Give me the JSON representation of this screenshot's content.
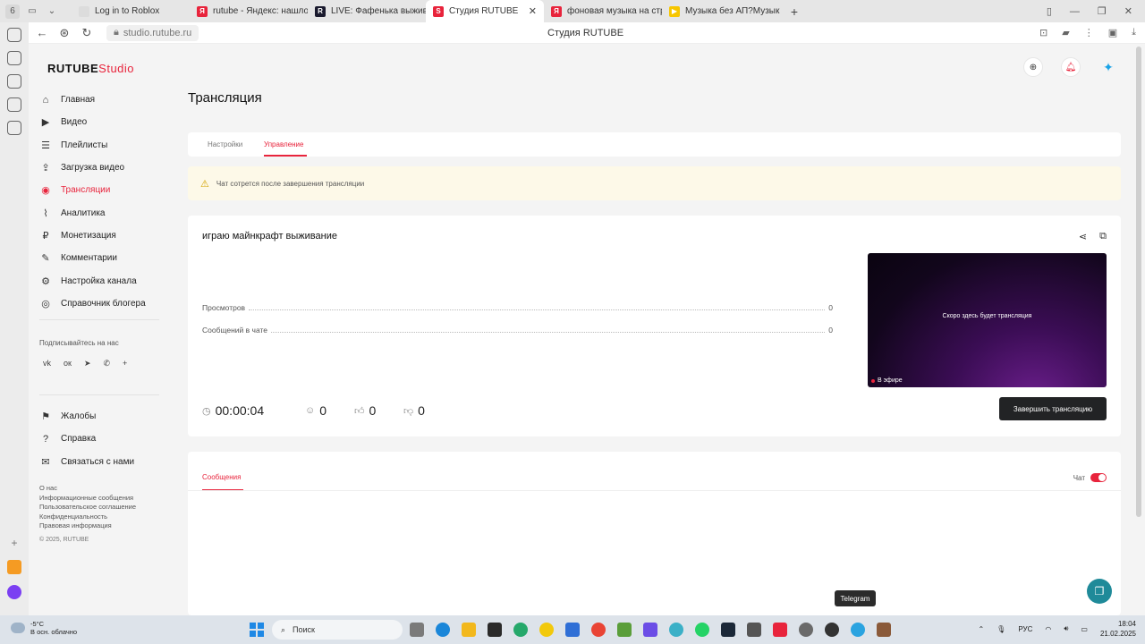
{
  "browser": {
    "tabs": [
      {
        "label": "Log in to Roblox",
        "color": "#dcdcdc",
        "fav": ""
      },
      {
        "label": "rutube - Яндекс: нашлось",
        "color": "#e8243c",
        "fav": "Я"
      },
      {
        "label": "LIVE: Фафенька выживание",
        "color": "#1a1a2e",
        "fav": "R"
      },
      {
        "label": "Студия RUTUBE",
        "color": "#e8243c",
        "fav": "S",
        "active": true
      },
      {
        "label": "фоновая музыка на стри",
        "color": "#e8243c",
        "fav": "Я"
      },
      {
        "label": "Музыка без АП?Музыка д",
        "color": "#f7c600",
        "fav": "▶"
      }
    ],
    "url": "studio.rutube.ru",
    "page_title": "Студия RUTUBE"
  },
  "sidebar": {
    "logo_main": "RUTUBE",
    "logo_studio": "Studio",
    "items": [
      {
        "label": "Главная",
        "icon": "⌂",
        "name": "home"
      },
      {
        "label": "Видео",
        "icon": "▶",
        "name": "video"
      },
      {
        "label": "Плейлисты",
        "icon": "☰",
        "name": "playlists"
      },
      {
        "label": "Загрузка видео",
        "icon": "⇪",
        "name": "upload"
      },
      {
        "label": "Трансляции",
        "icon": "◉",
        "name": "streams",
        "active": true
      },
      {
        "label": "Аналитика",
        "icon": "⌇",
        "name": "analytics"
      },
      {
        "label": "Монетизация",
        "icon": "₽",
        "name": "monetization"
      },
      {
        "label": "Комментарии",
        "icon": "✎",
        "name": "comments"
      },
      {
        "label": "Настройка канала",
        "icon": "⚙",
        "name": "channel-settings"
      },
      {
        "label": "Справочник блогера",
        "icon": "◎",
        "name": "blogger-guide"
      }
    ],
    "subscribe_label": "Подписывайтесь на нас",
    "socials": [
      "vk",
      "ok",
      "tg",
      "vb",
      "+"
    ],
    "items2": [
      {
        "label": "Жалобы",
        "icon": "⚑",
        "name": "complaints"
      },
      {
        "label": "Справка",
        "icon": "?",
        "name": "help"
      },
      {
        "label": "Связаться с нами",
        "icon": "✉",
        "name": "contact"
      }
    ],
    "footer_links": [
      "О нас",
      "Информационные сообщения",
      "Пользовательское соглашение",
      "Конфиденциальность",
      "Правовая информация"
    ],
    "copyright": "© 2025, RUTUBE"
  },
  "main": {
    "title": "Трансляция",
    "tabs": [
      "Настройки",
      "Управление"
    ],
    "warning": "Чат сотрется после завершения трансляции",
    "stream": {
      "title": "играю майнкрафт выживание",
      "stats": [
        {
          "label": "Просмотров",
          "value": "0"
        },
        {
          "label": "Сообщений в чате",
          "value": "0"
        }
      ],
      "preview_text": "Скоро здесь будет трансляция",
      "live_label": "В эфире",
      "timer": "00:00:04",
      "viewers": "0",
      "likes": "0",
      "dislikes": "0",
      "end_button": "Завершить трансляцию"
    },
    "chat": {
      "tab": "Сообщения",
      "toggle_label": "Чат"
    }
  },
  "tooltip": "Telegram",
  "taskbar": {
    "weather_temp": "-5°C",
    "weather_desc": "В осн. облачно",
    "search_label": "Поиск",
    "lang": "РУС",
    "time": "18:04",
    "date": "21.02.2025"
  }
}
